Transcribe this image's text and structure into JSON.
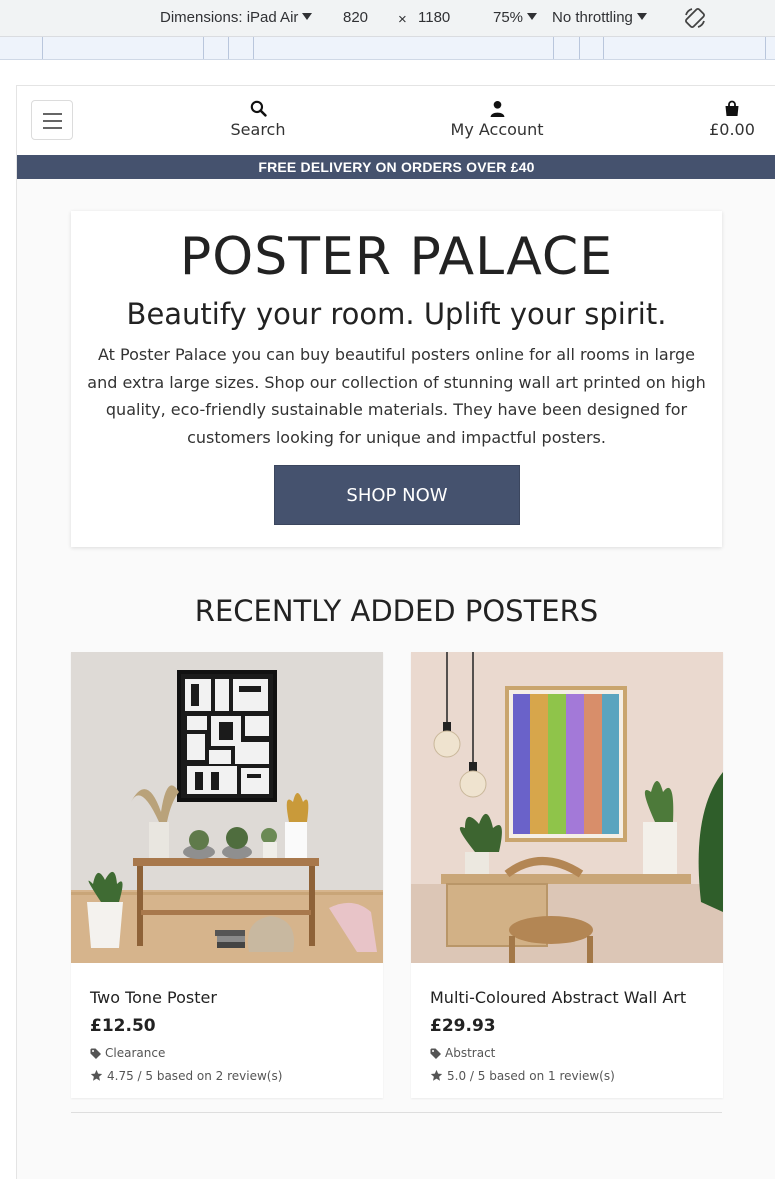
{
  "devtools": {
    "dimensions_label": "Dimensions: iPad Air",
    "width": "820",
    "times": "×",
    "height": "1180",
    "zoom": "75%",
    "throttling": "No throttling"
  },
  "nav": {
    "search_label": "Search",
    "account_label": "My Account",
    "cart_total": "£0.00"
  },
  "banner": "FREE DELIVERY ON ORDERS OVER £40",
  "hero": {
    "title": "POSTER PALACE",
    "subtitle": "Beautify your room. Uplift your spirit.",
    "description": "At Poster Palace you can buy beautiful posters online for all rooms in large and extra large sizes. Shop our collection of stunning wall art printed on high quality, eco-friendly sustainable materials. They have been designed for customers looking for unique and impactful posters.",
    "button": "SHOP NOW"
  },
  "recent": {
    "title": "RECENTLY ADDED POSTERS",
    "products": [
      {
        "name": "Two Tone Poster",
        "price": "£12.50",
        "category": "Clearance",
        "rating": "4.75 / 5 based on 2 review(s)"
      },
      {
        "name": "Multi-Coloured Abstract Wall Art",
        "price": "£29.93",
        "category": "Abstract",
        "rating": "5.0 / 5 based on 1 review(s)"
      }
    ]
  },
  "colors": {
    "brand": "#45526e",
    "background": "#fafafa"
  }
}
